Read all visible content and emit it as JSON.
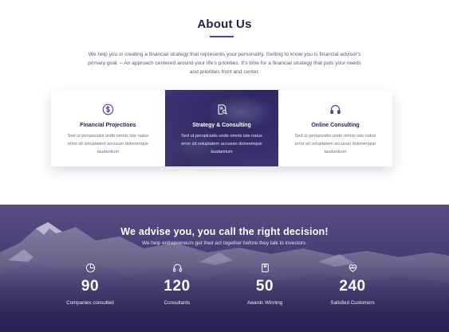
{
  "about": {
    "title": "About Us",
    "intro": "We help you in creating a financial strategy that represents your personality. Getting to know you is financial advisor's primary goal. – An approach centered around your life's priorities. It's time for a financial strategy that puts your needs and priorities front and center."
  },
  "services": [
    {
      "icon": "dollar-circle-icon",
      "title": "Financial Projections",
      "text": "Sed ut perspiciatis unde omnis iste natus error sit voluptatem accusan doloremque laudantium"
    },
    {
      "icon": "document-search-icon",
      "title": "Strategy & Consulting",
      "text": "Sed ut perspiciatis unde omnis iste natus error sit voluptatem accusan doloremque laudantium"
    },
    {
      "icon": "headphones-icon",
      "title": "Online Consulting",
      "text": "Sed ut perspiciatis unde omnis iste natus error sit voluptatem accusan doloremque laudantium"
    }
  ],
  "hero": {
    "title": "We advise you, you call the right decision!",
    "subtitle": "We help entrepreneurs get their act together before they talk to investors."
  },
  "stats": [
    {
      "icon": "pie-chart-icon",
      "value": "90",
      "label": "Companies consulted"
    },
    {
      "icon": "headphones-icon",
      "value": "120",
      "label": "Consultants"
    },
    {
      "icon": "book-icon",
      "value": "50",
      "label": "Awards Winning"
    },
    {
      "icon": "heart-pulse-icon",
      "value": "240",
      "label": "Satisfied Customers"
    }
  ],
  "colors": {
    "accent": "#5b3fa3",
    "heading": "#1f2340",
    "featured_card": "#2e2762",
    "hero_background": "#3a2f66"
  }
}
